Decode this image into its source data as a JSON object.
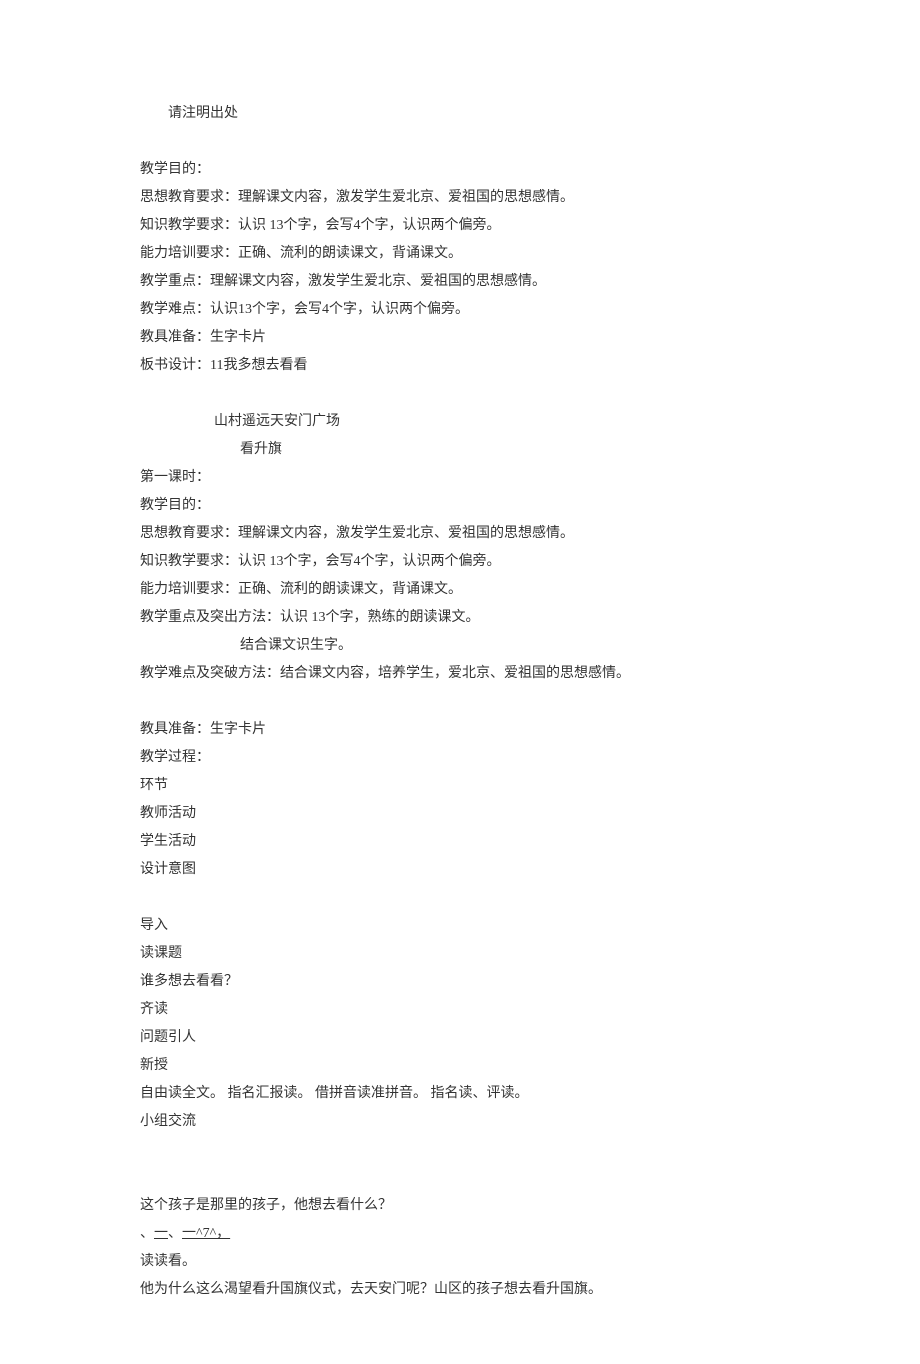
{
  "header": {
    "attribution": "请注明出处"
  },
  "section1": {
    "objective_title": "教学目的：",
    "ideological": "思想教育要求：理解课文内容，激发学生爱北京、爱祖国的思想感情。",
    "knowledge": "知识教学要求：认识 13个字，会写4个字，认识两个偏旁。",
    "ability": "能力培训要求：正确、流利的朗读课文，背诵课文。",
    "emphasis": "教学重点：理解课文内容，激发学生爱北京、爱祖国的思想感情。",
    "difficulty": "教学难点：认识13个字，会写4个字，认识两个偏旁。",
    "tools": "教具准备：生字卡片",
    "board": "板书设计：11我多想去看看",
    "board_line1": "山村遥远天安门广场",
    "board_line2": "看升旗"
  },
  "section2": {
    "lesson_title": "第一课时：",
    "objective_title": "教学目的：",
    "ideological": "思想教育要求：理解课文内容，激发学生爱北京、爱祖国的思想感情。",
    "knowledge": "知识教学要求：认识 13个字，会写4个字，认识两个偏旁。",
    "ability": "能力培训要求：正确、流利的朗读课文，背诵课文。",
    "emphasis": "教学重点及突出方法：认识 13个字，熟练的朗读课文。",
    "emphasis_sub": "结合课文识生字。",
    "difficulty": "教学难点及突破方法：结合课文内容，培养学生，爱北京、爱祖国的思想感情。",
    "tools": "教具准备：生字卡片",
    "process_title": "教学过程：",
    "col1": "环节",
    "col2": "教师活动",
    "col3": "学生活动",
    "col4": "设计意图"
  },
  "body": {
    "intro": "导入",
    "read_title": "读课题",
    "who": "谁多想去看看？",
    "qi_read": "齐读",
    "question_intro": "问题引人",
    "xin_shou": "新授",
    "free_read": " 自由读全文。  指名汇报读。  借拼音读准拼音。  指名读、评读。",
    "group": "小组交流",
    "q1": "这个孩子是那里的孩子，他想去看什么？",
    "symbols": "、",
    "sym1": "一",
    "sym_mid": "、",
    "sym2": "一^7^，",
    "read_dudukan": "读读看。",
    "q2": "他为什么这么渴望看升国旗仪式，去天安门呢？山区的孩子想去看升国旗。"
  }
}
